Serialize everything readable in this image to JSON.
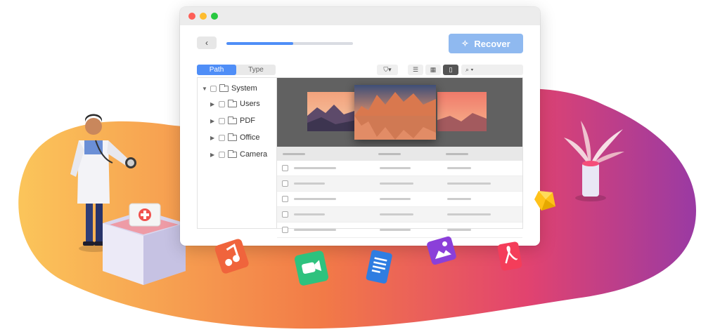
{
  "window": {
    "toolbar": {
      "back_label": "‹",
      "progress": 0.53,
      "recover_label": "Recover"
    },
    "subbar": {
      "tabs": [
        {
          "label": "Path",
          "active": true
        },
        {
          "label": "Type",
          "active": false
        }
      ],
      "filter_icon": "filter-icon",
      "filter_caret": "▾",
      "views": [
        {
          "icon": "list-view-icon",
          "glyph": "☰",
          "active": false
        },
        {
          "icon": "grid-view-icon",
          "glyph": "▦",
          "active": false
        },
        {
          "icon": "gallery-view-icon",
          "glyph": "▯",
          "active": true
        }
      ],
      "search_icon": "search-icon",
      "search_glyph": "⌕ ▾"
    },
    "tree": {
      "items": [
        {
          "label": "System",
          "caret": "▼",
          "expanded": true
        },
        {
          "label": "Users",
          "caret": "▶"
        },
        {
          "label": "PDF",
          "caret": "▶"
        },
        {
          "label": "Office",
          "caret": "▶"
        },
        {
          "label": "Camera",
          "caret": "▶"
        }
      ]
    }
  },
  "colors": {
    "accent": "#4f8ef7",
    "recover_button": "#8fb9f0",
    "preview_bg": "#616161"
  },
  "decorations": [
    "doctor-illustration",
    "first-aid-kit-icon",
    "music-file-icon",
    "video-file-icon",
    "document-file-icon",
    "image-file-icon",
    "pdf-file-icon",
    "plant-illustration",
    "gem-icon"
  ]
}
